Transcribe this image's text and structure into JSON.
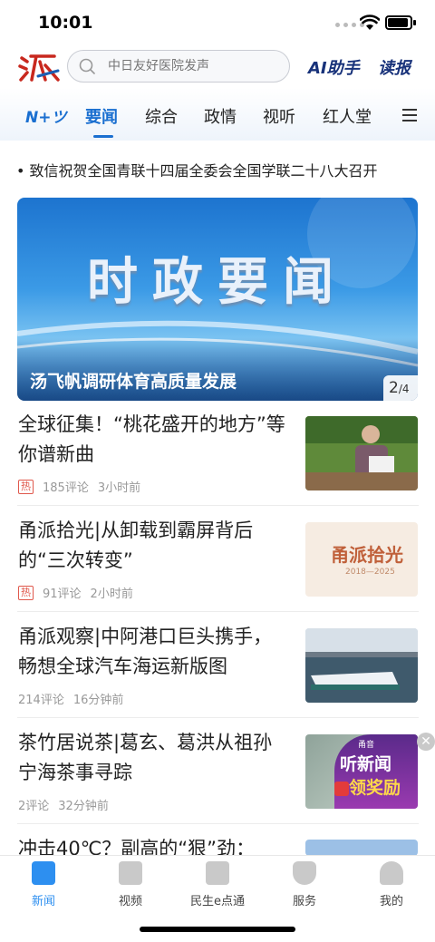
{
  "status_bar": {
    "time": "10:01"
  },
  "header": {
    "search_placeholder": "中日友好医院发声",
    "ai_label": "AI助手",
    "read_label": "读报"
  },
  "tabs": {
    "logo_tab": "N+ツ",
    "items": [
      {
        "label": "要闻",
        "active": true
      },
      {
        "label": "综合",
        "active": false
      },
      {
        "label": "政情",
        "active": false
      },
      {
        "label": "视听",
        "active": false
      },
      {
        "label": "红人堂",
        "active": false
      }
    ]
  },
  "marquee": {
    "text": "• 致信祝贺全国青联十四届全委会全国学联二十八大召开"
  },
  "banner": {
    "big_text": "时政要闻",
    "caption": "汤飞帆调研体育高质量发展",
    "page_current": "2",
    "page_total": "/4"
  },
  "news": [
    {
      "title": "全球征集！“桃花盛开的地方”等你谱新曲",
      "hot": "热",
      "comments": "185评论",
      "time": "3小时前"
    },
    {
      "title": "甬派拾光|从卸载到霸屏背后的“三次转变”",
      "hot": "热",
      "comments": "91评论",
      "time": "2小时前",
      "thumb_text": "甬派拾光",
      "thumb_sub": "2018—2025"
    },
    {
      "title": "甬派观察|中阿港口巨头携手，畅想全球汽车海运新版图",
      "comments": "214评论",
      "time": "16分钟前"
    },
    {
      "title": "茶竹居说茶|葛玄、葛洪从祖孙宁海茶事寻踪",
      "comments": "2评论",
      "time": "32分钟前",
      "ad_brand": "甬音",
      "ad_line1": "听新闻",
      "ad_line2": "领奖励"
    },
    {
      "title": "冲击40℃？副高的“狠”劲："
    }
  ],
  "bottom_nav": [
    {
      "label": "新闻",
      "active": true
    },
    {
      "label": "视频"
    },
    {
      "label": "民生e点通"
    },
    {
      "label": "服务"
    },
    {
      "label": "我的"
    }
  ],
  "colors": {
    "accent": "#1a6fd0",
    "hot": "#e0584c",
    "brand_dark": "#18327a"
  }
}
